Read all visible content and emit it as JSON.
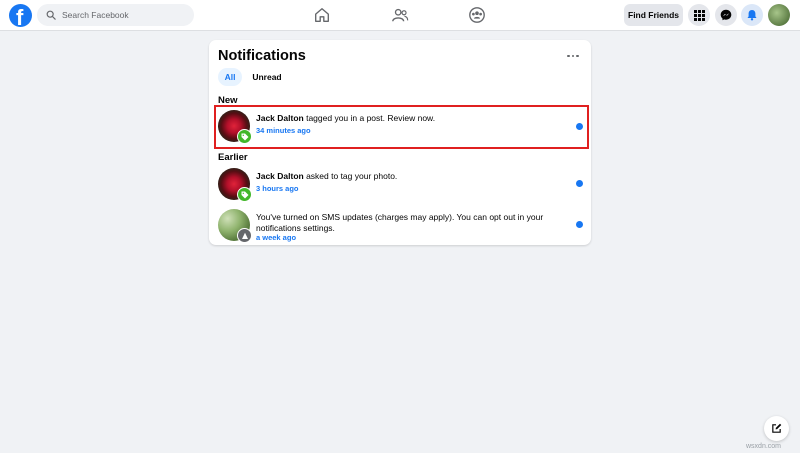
{
  "topbar": {
    "search_placeholder": "Search Facebook",
    "find_friends_label": "Find Friends",
    "brand_color": "#1877f2",
    "icons": [
      "facebook-logo",
      "search-icon",
      "home-icon",
      "friends-icon",
      "groups-icon",
      "menu-grid-icon",
      "messenger-icon",
      "notifications-bell-icon",
      "profile-avatar"
    ]
  },
  "notifications": {
    "title": "Notifications",
    "tabs": [
      {
        "label": "All",
        "active": true
      },
      {
        "label": "Unread",
        "active": false
      }
    ],
    "sections": {
      "new_label": "New",
      "earlier_label": "Earlier"
    },
    "items": [
      {
        "actor": "Jack Dalton",
        "message": " tagged you in a post. Review now.",
        "time": "34 minutes ago",
        "badge": "tag-icon",
        "unread": true
      },
      {
        "actor": "Jack Dalton",
        "message": " asked to tag your photo.",
        "time": "3 hours ago",
        "badge": "tag-icon",
        "unread": true
      },
      {
        "actor": "",
        "message": "You've turned on SMS updates (charges may apply). You can opt out in your notifications settings.",
        "time": "a week ago",
        "badge": "sms-icon",
        "unread": true
      }
    ]
  },
  "watermark": "wsxdn.com"
}
